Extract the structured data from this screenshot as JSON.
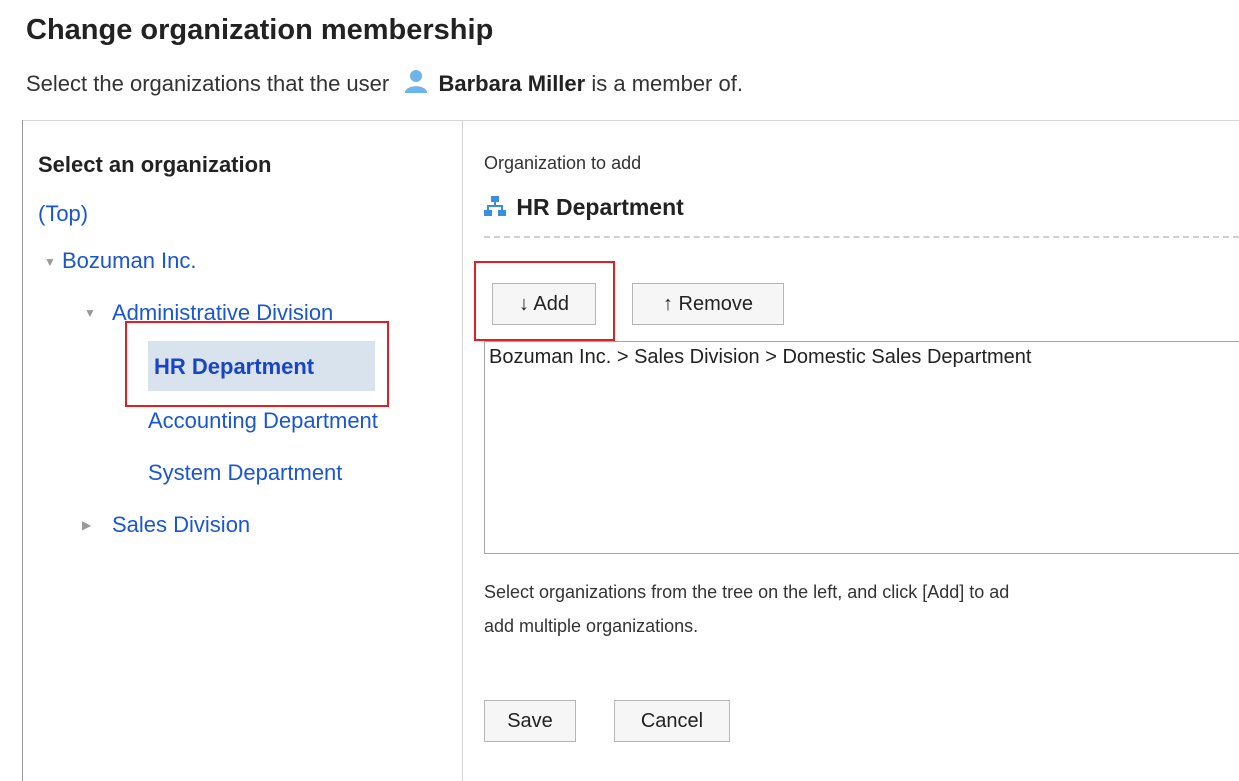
{
  "header": {
    "title": "Change organization membership",
    "subtitle_prefix": "Select the organizations that the user",
    "user_name": "Barbara Miller",
    "subtitle_suffix": "is a member of.",
    "user_icon": "user-icon"
  },
  "tree": {
    "heading": "Select an organization",
    "top_link": "(Top)",
    "items": [
      {
        "label": "Bozuman Inc.",
        "expanded": true
      },
      {
        "label": "Administrative Division",
        "expanded": true
      },
      {
        "label": "HR Department",
        "selected": true
      },
      {
        "label": "Accounting Department"
      },
      {
        "label": "System Department"
      },
      {
        "label": "Sales Division",
        "expanded": false
      }
    ]
  },
  "right": {
    "label": "Organization to add",
    "target_org": "HR Department",
    "org_icon": "org-chart-icon",
    "add_button": "↓ Add",
    "remove_button": "↑ Remove",
    "list_items": [
      "Bozuman Inc. > Sales Division > Domestic Sales Department"
    ],
    "help_line1": "Select organizations from the tree on the left, and click [Add] to ad",
    "help_line2": "add multiple organizations.",
    "save_button": "Save",
    "cancel_button": "Cancel"
  },
  "colors": {
    "link": "#1a55d6",
    "selected_bg": "#d9e3ee",
    "highlight_border": "#e01e24"
  }
}
